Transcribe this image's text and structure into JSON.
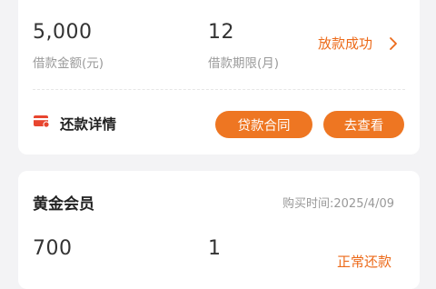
{
  "loan1": {
    "amount": "5,000",
    "amount_label": "借款金额(元)",
    "term": "12",
    "term_label": "借款期限(月)",
    "status": "放款成功",
    "repay_title": "还款详情",
    "contract_button": "贷款合同",
    "view_button": "去查看"
  },
  "membership": {
    "title": "黄金会员",
    "purchase_time": "购买时间:2025/4/09",
    "price": "700",
    "count": "1",
    "status": "正常还款"
  },
  "colors": {
    "accent": "#ec6a19",
    "button": "#ee7622",
    "background": "#f3f3f5"
  }
}
